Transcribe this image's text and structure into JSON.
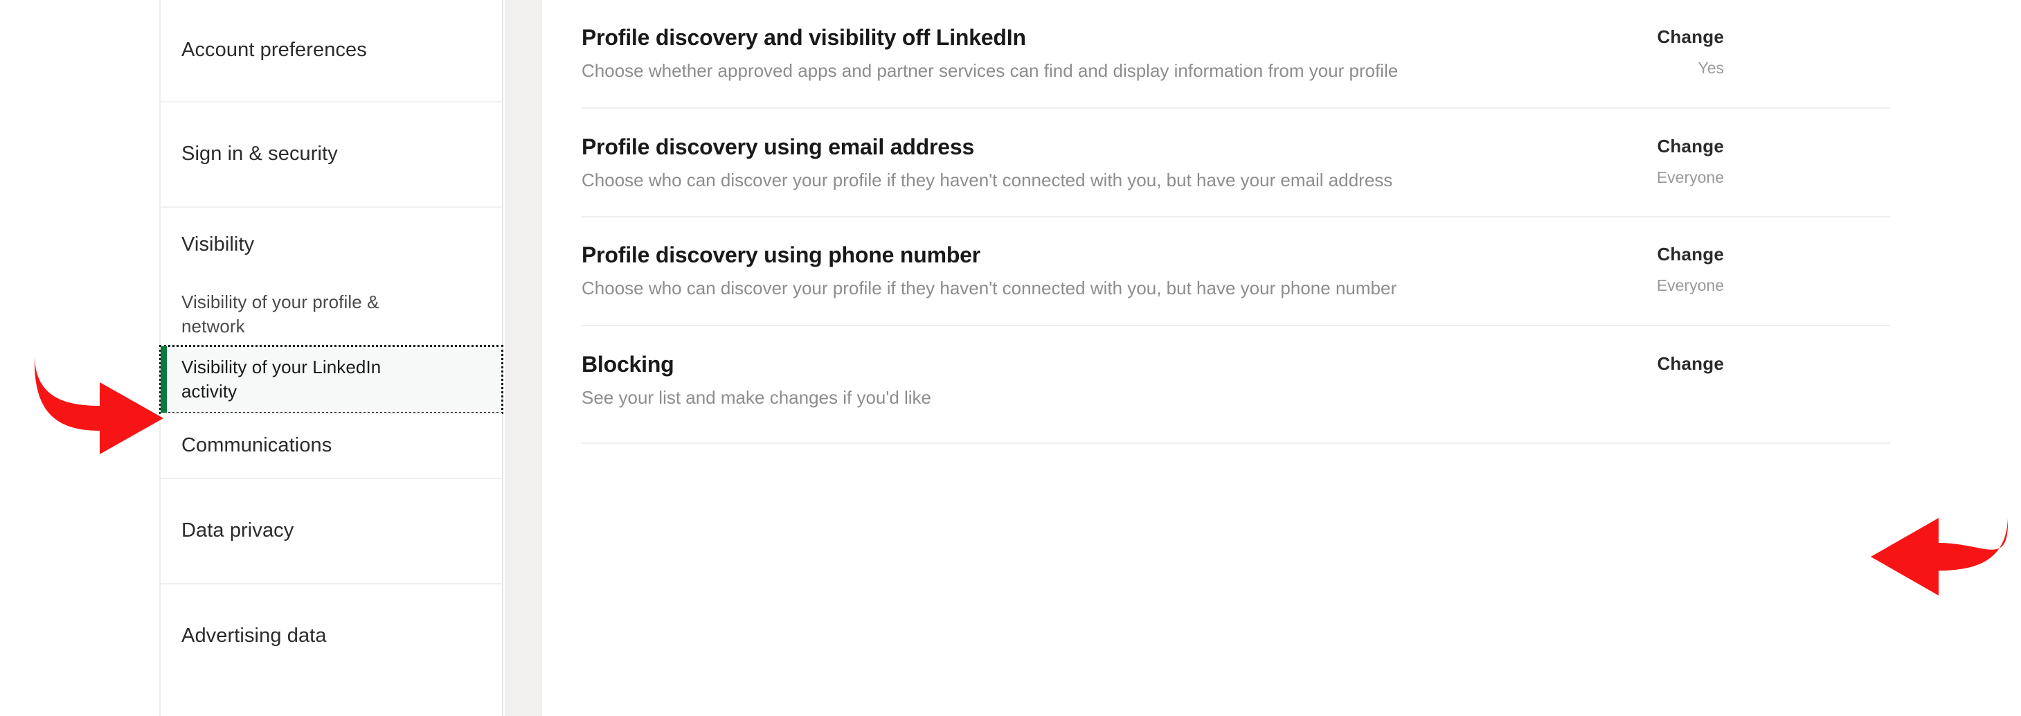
{
  "sidebar": {
    "items": [
      {
        "label": "Account preferences",
        "type": "top",
        "selected": false
      },
      {
        "label": "Sign in & security",
        "type": "top",
        "selected": false
      },
      {
        "label": "Visibility",
        "type": "top",
        "selected": false
      },
      {
        "label": "Visibility of your profile & network",
        "type": "sub",
        "selected": false
      },
      {
        "label": "Visibility of your LinkedIn activity",
        "type": "sub",
        "selected": true
      },
      {
        "label": "Communications",
        "type": "top",
        "selected": false
      },
      {
        "label": "Data privacy",
        "type": "top",
        "selected": false
      },
      {
        "label": "Advertising data",
        "type": "top",
        "selected": false
      }
    ],
    "selected_accent_color": "#0a7a3d",
    "selected_background_color": "#f7f9f8"
  },
  "main": {
    "rows": [
      {
        "title": "Profile discovery and visibility off LinkedIn",
        "description": "Choose whether approved apps and partner services can find and display information from your profile",
        "action_label": "Change",
        "current_value": "Yes"
      },
      {
        "title": "Profile discovery using email address",
        "description": "Choose who can discover your profile if they haven't connected with you, but have your email address",
        "action_label": "Change",
        "current_value": "Everyone"
      },
      {
        "title": "Profile discovery using phone number",
        "description": "Choose who can discover your profile if they haven't connected with you, but have your phone number",
        "action_label": "Change",
        "current_value": "Everyone"
      },
      {
        "title": "Blocking",
        "description": "See your list and make changes if you'd like",
        "action_label": "Change",
        "current_value": ""
      }
    ]
  },
  "annotations": {
    "arrow_color": "#f71414",
    "arrow_sidebar": "curved-arrow-right-icon",
    "arrow_blocking": "curved-arrow-left-icon"
  }
}
